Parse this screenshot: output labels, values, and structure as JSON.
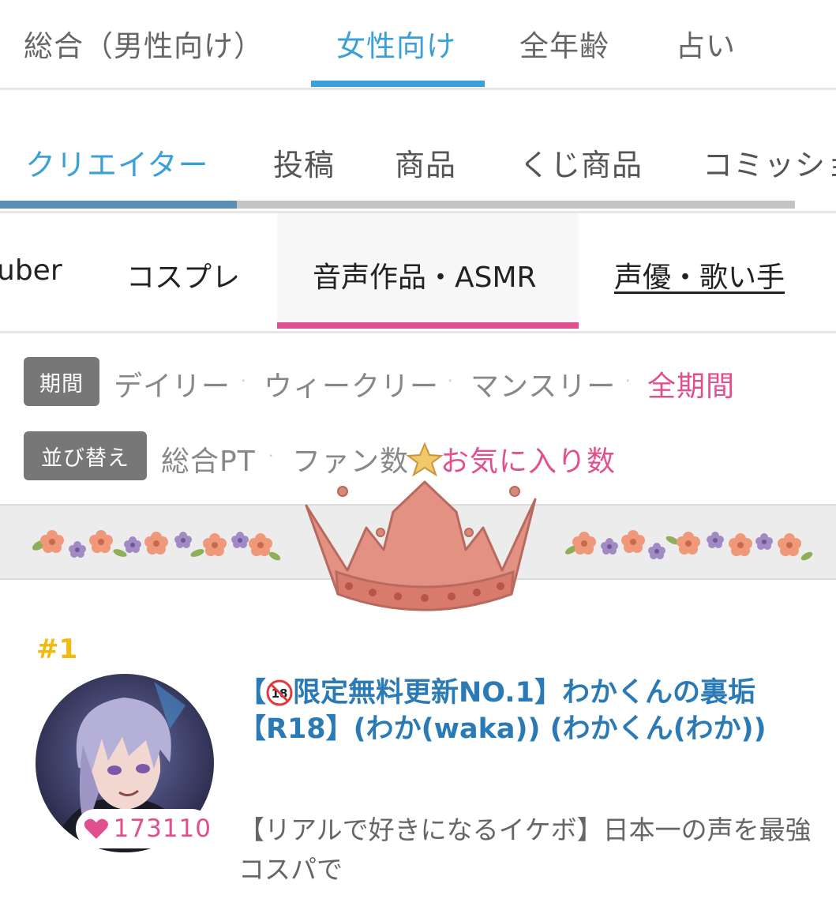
{
  "top_tabs": [
    {
      "label": "総合（男性向け）",
      "active": false
    },
    {
      "label": "女性向け",
      "active": true
    },
    {
      "label": "全年齢",
      "active": false
    },
    {
      "label": "占い",
      "active": false
    }
  ],
  "category_tabs": [
    {
      "label": "クリエイター",
      "active": true
    },
    {
      "label": "投稿",
      "active": false
    },
    {
      "label": "商品",
      "active": false
    },
    {
      "label": "くじ商品",
      "active": false
    },
    {
      "label": "コミッショ",
      "active": false
    }
  ],
  "genre_tabs": [
    {
      "label": "uber",
      "active": false
    },
    {
      "label": "コスプレ",
      "active": false
    },
    {
      "label": "音声作品・ASMR",
      "active": true
    },
    {
      "label": "声優・歌い手",
      "active": false
    }
  ],
  "period_filter": {
    "label": "期間",
    "options": [
      "デイリー",
      "ウィークリー",
      "マンスリー",
      "全期間"
    ],
    "selected": "全期間"
  },
  "sort_filter": {
    "label": "並び替え",
    "options": [
      "総合PT",
      "ファン数",
      "お気に入り数"
    ],
    "selected": "お気に入り数"
  },
  "separator": "·",
  "ranking": {
    "rank": "#1",
    "title_prefix": "【",
    "title": "限定無料更新NO.1】わかくんの裏垢【R18】(わか(waka)) (わかくん(わか))",
    "favorites": "173110",
    "description": "【リアルで好きになるイケボ】日本一の声を最強コスパで"
  },
  "colors": {
    "blue_accent": "#3ca0d8",
    "pink_accent": "#e0508e",
    "rank_gold": "#f2b90f",
    "title_blue": "#2a7ab5"
  }
}
